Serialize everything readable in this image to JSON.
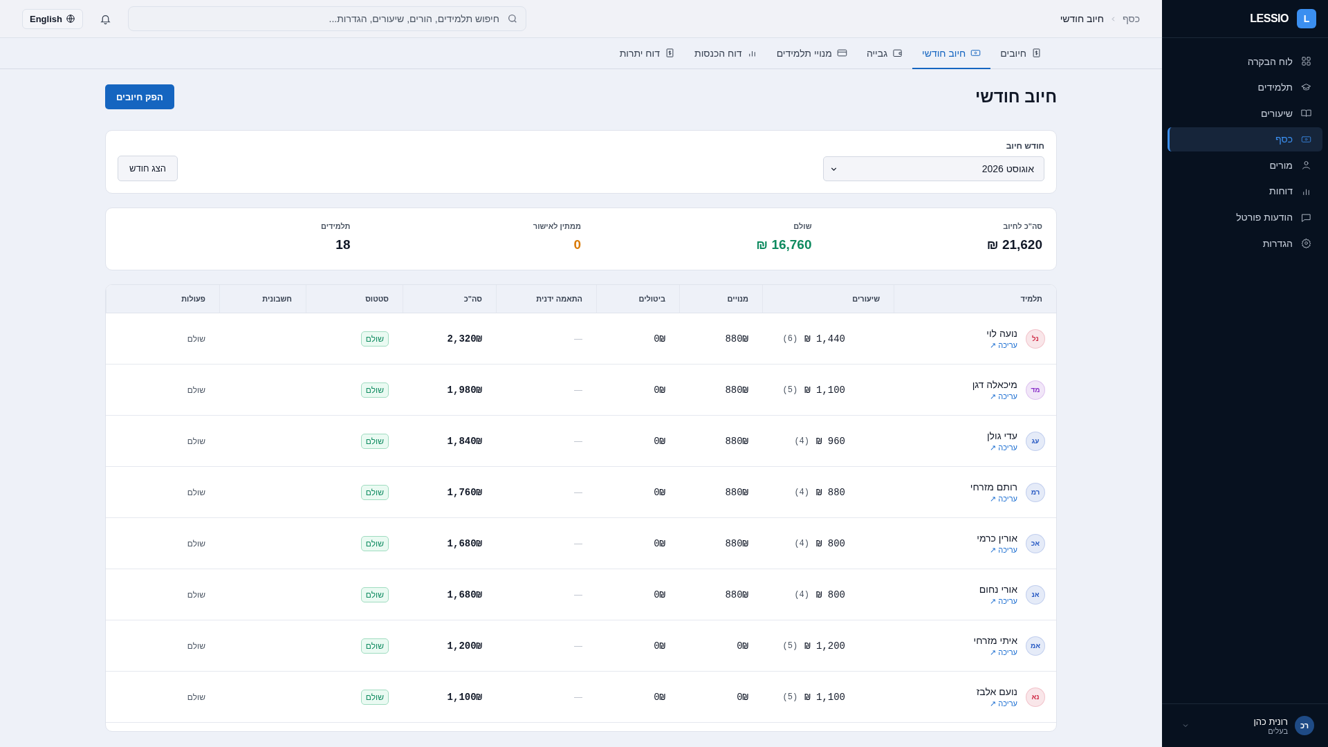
{
  "sidebar": {
    "logo_letter": "L",
    "brand": "LESSIO",
    "items": [
      {
        "label": "לוח הבקרה",
        "selected": false
      },
      {
        "label": "תלמידים",
        "selected": false
      },
      {
        "label": "שיעורים",
        "selected": false
      },
      {
        "label": "כסף",
        "selected": true
      },
      {
        "label": "מורים",
        "selected": false
      },
      {
        "label": "דוחות",
        "selected": false
      },
      {
        "label": "הודעות פורטל",
        "selected": false
      },
      {
        "label": "הגדרות",
        "selected": false
      }
    ],
    "user": {
      "initials": "רכ",
      "name": "רונית כהן",
      "role": "בעלים"
    }
  },
  "topbar": {
    "breadcrumb": [
      "כסף",
      "חיוב חודשי"
    ],
    "search": {
      "placeholder": "חיפוש תלמידים, הורים, שיעורים, הגדרות..."
    },
    "language": "English"
  },
  "tabs": [
    {
      "label": "חיובים",
      "selected": false
    },
    {
      "label": "חיוב חודשי",
      "selected": true
    },
    {
      "label": "גבייה",
      "selected": false
    },
    {
      "label": "מנויי תלמידים",
      "selected": false
    },
    {
      "label": "דוח הכנסות",
      "selected": false
    },
    {
      "label": "דוח יתרות",
      "selected": false
    }
  ],
  "page": {
    "title": "חיוב חודשי",
    "primary_button": "הפק חיובים"
  },
  "filter": {
    "label": "חודש חיוב",
    "value": "אוגוסט 2026",
    "button": "הצג חודש"
  },
  "summary": [
    {
      "label": "סה\"כ לחיוב",
      "value": "₪ 21,620",
      "color": "#111827"
    },
    {
      "label": "שולם",
      "value": "₪ 16,760",
      "color": "#0d8a5f"
    },
    {
      "label": "ממתין לאישור",
      "value": "0",
      "color": "#d97a06"
    },
    {
      "label": "תלמידים",
      "value": "18",
      "color": "#111827"
    }
  ],
  "table": {
    "columns": [
      "תלמיד",
      "שיעורים",
      "מנויים",
      "ביטולים",
      "התאמה ידנית",
      "סה\"כ",
      "סטטוס",
      "חשבונית",
      "פעולות"
    ],
    "rows": [
      {
        "initials": "נל",
        "color": "#d0304a",
        "name": "נועה לוי",
        "edit": "עריכה ↗",
        "lessons": "₪ 1,440",
        "count": "(6)",
        "subs": "880₪",
        "cancel": "0₪",
        "manual": "—",
        "total": "2,320₪",
        "status": "שולם",
        "action": "שולם"
      },
      {
        "initials": "מד",
        "color": "#8a2fc9",
        "name": "מיכאלה דגן",
        "edit": "עריכה ↗",
        "lessons": "₪ 1,100",
        "count": "(5)",
        "subs": "880₪",
        "cancel": "0₪",
        "manual": "—",
        "total": "1,980₪",
        "status": "שולם",
        "action": "שולם"
      },
      {
        "initials": "עג",
        "color": "#2b5cc4",
        "name": "עדי גולן",
        "edit": "עריכה ↗",
        "lessons": "₪ 960",
        "count": "(4)",
        "subs": "880₪",
        "cancel": "0₪",
        "manual": "—",
        "total": "1,840₪",
        "status": "שולם",
        "action": "שולם"
      },
      {
        "initials": "רמ",
        "color": "#2b5cc4",
        "name": "רותם מזרחי",
        "edit": "עריכה ↗",
        "lessons": "₪ 880",
        "count": "(4)",
        "subs": "880₪",
        "cancel": "0₪",
        "manual": "—",
        "total": "1,760₪",
        "status": "שולם",
        "action": "שולם"
      },
      {
        "initials": "אכ",
        "color": "#2b5cc4",
        "name": "אורין כרמי",
        "edit": "עריכה ↗",
        "lessons": "₪ 800",
        "count": "(4)",
        "subs": "880₪",
        "cancel": "0₪",
        "manual": "—",
        "total": "1,680₪",
        "status": "שולם",
        "action": "שולם"
      },
      {
        "initials": "אנ",
        "color": "#2b5cc4",
        "name": "אורי נחום",
        "edit": "עריכה ↗",
        "lessons": "₪ 800",
        "count": "(4)",
        "subs": "880₪",
        "cancel": "0₪",
        "manual": "—",
        "total": "1,680₪",
        "status": "שולם",
        "action": "שולם"
      },
      {
        "initials": "אמ",
        "color": "#2b5cc4",
        "name": "איתי מזרחי",
        "edit": "עריכה ↗",
        "lessons": "₪ 1,200",
        "count": "(5)",
        "subs": "0₪",
        "cancel": "0₪",
        "manual": "—",
        "total": "1,200₪",
        "status": "שולם",
        "action": "שולם"
      },
      {
        "initials": "נא",
        "color": "#d0304a",
        "name": "נועם אלבז",
        "edit": "עריכה ↗",
        "lessons": "₪ 1,100",
        "count": "(5)",
        "subs": "0₪",
        "cancel": "0₪",
        "manual": "—",
        "total": "1,100₪",
        "status": "שולם",
        "action": "שולם"
      }
    ]
  }
}
